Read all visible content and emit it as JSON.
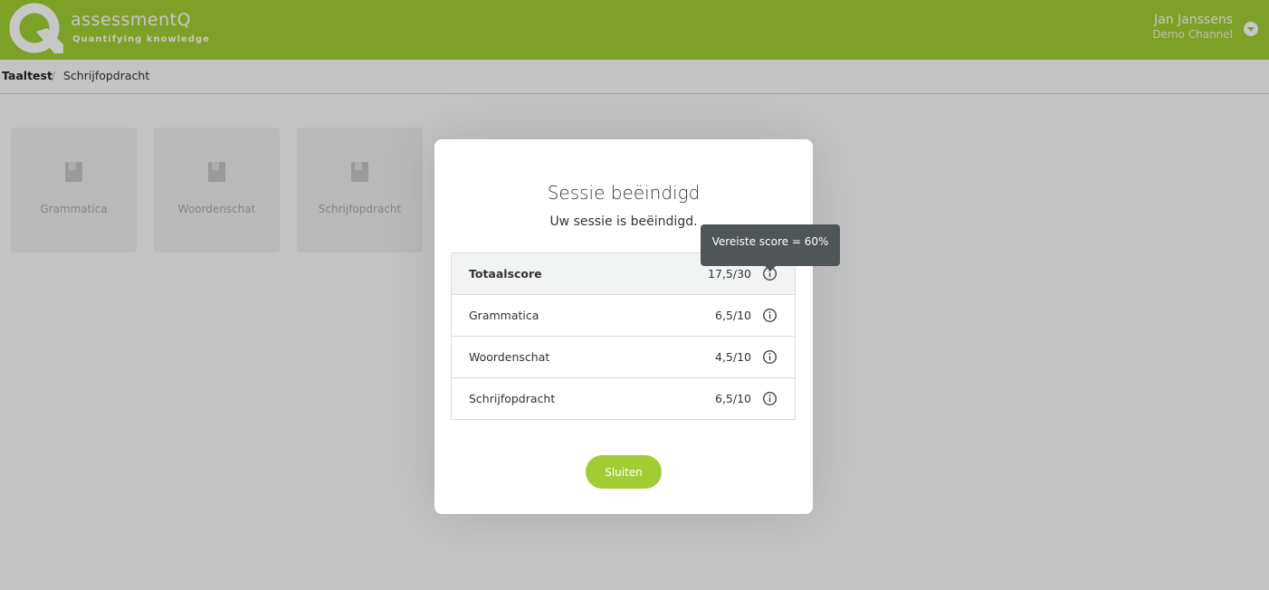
{
  "header": {
    "logo_name": "assessmentQ",
    "logo_tagline": "Quantifying knowledge",
    "user_name": "Jan Janssens",
    "user_channel": "Demo Channel",
    "brand_color": "#a0cd33"
  },
  "breadcrumb": {
    "items": [
      "Taaltest",
      "Schrijfopdracht"
    ],
    "separator": "/"
  },
  "tiles": [
    {
      "label": "Grammatica",
      "icon": "book-icon"
    },
    {
      "label": "Woordenschat",
      "icon": "book-icon"
    },
    {
      "label": "Schrijfopdracht",
      "icon": "book-icon"
    }
  ],
  "modal": {
    "title": "Sessie beëindigd",
    "subtitle": "Uw sessie is beëindigd.",
    "rows": [
      {
        "label": "Totaalscore",
        "score": "17,5/30",
        "icon": "info-icon"
      },
      {
        "label": "Grammatica",
        "score": "6,5/10",
        "icon": "info-icon"
      },
      {
        "label": "Woordenschat",
        "score": "4,5/10",
        "icon": "info-icon"
      },
      {
        "label": "Schrijfopdracht",
        "score": "6,5/10",
        "icon": "info-icon"
      }
    ],
    "close_label": "Sluiten"
  },
  "tooltip": {
    "text": "Vereiste score = 60%"
  }
}
